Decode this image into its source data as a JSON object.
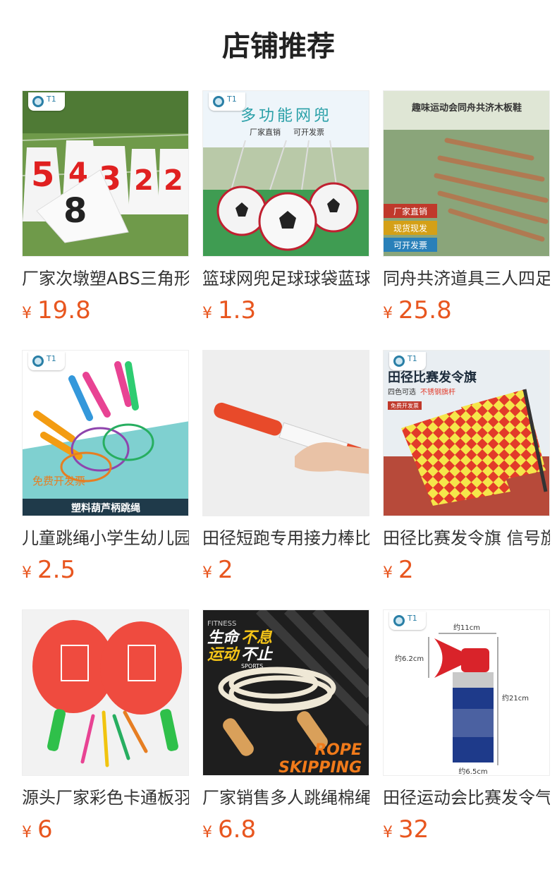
{
  "header": {
    "title": "店铺推荐"
  },
  "currency": "¥",
  "products": [
    {
      "name": "厂家次墩塑ABS三角形号码桩标志桶",
      "price": "19.8"
    },
    {
      "name": "篮球网兜足球球袋蓝球网袋",
      "price": "1.3"
    },
    {
      "name": "同舟共济道具三人四足木板鞋",
      "price": "25.8"
    },
    {
      "name": "儿童跳绳小学生幼儿园塑料葫芦柄",
      "price": "2.5"
    },
    {
      "name": "田径短跑专用接力棒比赛",
      "price": "2"
    },
    {
      "name": "田径比赛发令旗 信号旗",
      "price": "2"
    },
    {
      "name": "源头厂家彩色卡通板羽球拍",
      "price": "6"
    },
    {
      "name": "厂家销售多人跳绳棉绳",
      "price": "6.8"
    },
    {
      "name": "田径运动会比赛发令气笛",
      "price": "32"
    }
  ],
  "image_text": {
    "p1": {
      "nums": [
        "5",
        "4",
        "3",
        "2",
        "2",
        "8"
      ]
    },
    "p2": {
      "title": "多功能网兜",
      "sub1": "厂家直销",
      "sub2": "可开发票"
    },
    "p3": {
      "title": "趣味运动会同舟共济木板鞋",
      "tags": [
        "厂家直销",
        "现货现发",
        "可开发票"
      ]
    },
    "p4": {
      "promo": "免费开发票",
      "banner": "塑料葫芦柄跳绳"
    },
    "p6": {
      "title": "田径比赛发令旗",
      "sub1": "四色可选",
      "sub2": "不锈钢旗杆",
      "tag": "免费开发票"
    },
    "p8": {
      "fitness": "FITNESS",
      "l1a": "生命",
      "l1b": "不息",
      "l2a": "运动",
      "l2b": "不止",
      "sports": "SPORTS",
      "rope": "ROPE",
      "skipping": "SKIPPING"
    },
    "p9": {
      "w": "约11cm",
      "d": "约6.2cm",
      "h": "约21cm",
      "b": "约6.5cm"
    },
    "logo": "T1"
  }
}
